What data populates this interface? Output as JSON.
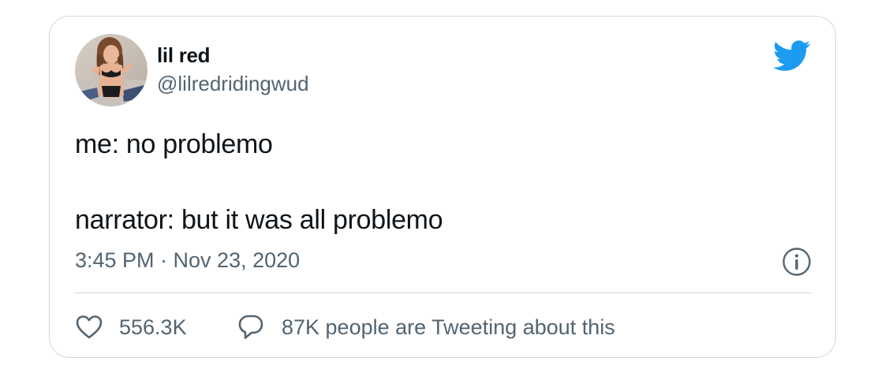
{
  "user": {
    "name": "lil red",
    "handle": "@lilredridingwud"
  },
  "tweet": {
    "lines": [
      "me: no problemo",
      "",
      "narrator: but it was all problemo"
    ],
    "timestamp": "3:45 PM · Nov 23, 2020"
  },
  "actions": {
    "likes": "556.3K",
    "conversation": "87K people are Tweeting about this"
  },
  "colors": {
    "twitter_blue": "#1d9bf0",
    "text_primary": "#0f1419",
    "text_secondary": "#536471",
    "border": "#cfd9de"
  },
  "icons": {
    "logo": "twitter-bird-icon",
    "info": "info-icon",
    "like": "heart-icon",
    "reply": "speech-bubble-icon"
  }
}
